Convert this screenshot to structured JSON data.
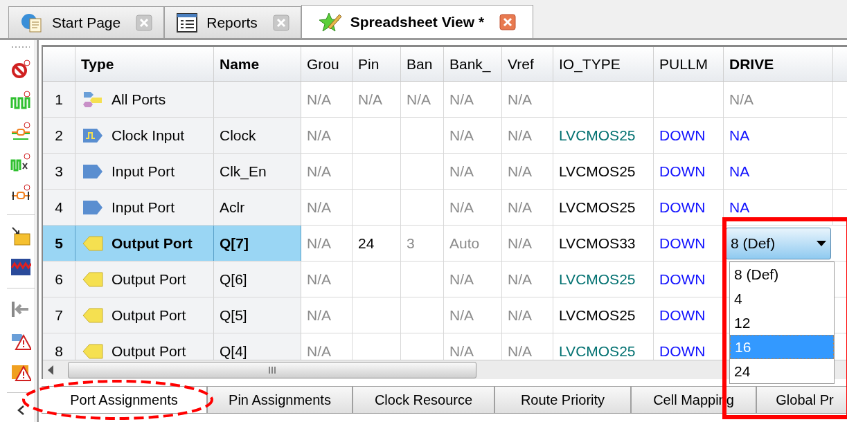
{
  "tabs": [
    {
      "label": "Start Page",
      "kind": "start",
      "selected": false
    },
    {
      "label": "Reports",
      "kind": "reports",
      "selected": false
    },
    {
      "label": "Spreadsheet View *",
      "kind": "spreadsheet",
      "selected": true
    }
  ],
  "table": {
    "columns": [
      {
        "label": "Type",
        "bold": true
      },
      {
        "label": "Name",
        "bold": true
      },
      {
        "label": "Grou",
        "bold": false
      },
      {
        "label": "Pin",
        "bold": false
      },
      {
        "label": "Ban",
        "bold": false
      },
      {
        "label": "Bank_",
        "bold": false
      },
      {
        "label": "Vref",
        "bold": false
      },
      {
        "label": "IO_TYPE",
        "bold": false
      },
      {
        "label": "PULLM",
        "bold": false
      },
      {
        "label": "DRIVE",
        "bold": true
      }
    ],
    "rows": [
      {
        "number": "1",
        "kind": "all",
        "selected": false,
        "cells": [
          {
            "text": "All Ports",
            "kind": "type"
          },
          null,
          {
            "text": "N/A",
            "kind": "dim"
          },
          {
            "text": "N/A",
            "kind": "dim"
          },
          {
            "text": "N/A",
            "kind": "dim"
          },
          {
            "text": "N/A",
            "kind": "dim"
          },
          {
            "text": "N/A",
            "kind": "dim"
          },
          null,
          null,
          {
            "text": "N/A",
            "kind": "dim"
          }
        ]
      },
      {
        "number": "2",
        "kind": "clock",
        "selected": false,
        "cells": [
          {
            "text": "Clock Input",
            "kind": "type"
          },
          {
            "text": "Clock",
            "kind": "name"
          },
          {
            "text": "N/A",
            "kind": "dim"
          },
          null,
          null,
          {
            "text": "N/A",
            "kind": "dim"
          },
          {
            "text": "N/A",
            "kind": "dim"
          },
          {
            "text": "LVCMOS25",
            "kind": "inherited"
          },
          {
            "text": "DOWN",
            "kind": "enum"
          },
          {
            "text": "NA",
            "kind": "enum"
          }
        ]
      },
      {
        "number": "3",
        "kind": "input",
        "selected": false,
        "cells": [
          {
            "text": "Input Port",
            "kind": "type"
          },
          {
            "text": "Clk_En",
            "kind": "name"
          },
          {
            "text": "N/A",
            "kind": "dim"
          },
          null,
          null,
          {
            "text": "N/A",
            "kind": "dim"
          },
          {
            "text": "N/A",
            "kind": "dim"
          },
          {
            "text": "LVCMOS25",
            "kind": "value"
          },
          {
            "text": "DOWN",
            "kind": "enum"
          },
          {
            "text": "NA",
            "kind": "enum"
          }
        ]
      },
      {
        "number": "4",
        "kind": "input",
        "selected": false,
        "cells": [
          {
            "text": "Input Port",
            "kind": "type"
          },
          {
            "text": "Aclr",
            "kind": "name"
          },
          {
            "text": "N/A",
            "kind": "dim"
          },
          null,
          null,
          {
            "text": "N/A",
            "kind": "dim"
          },
          {
            "text": "N/A",
            "kind": "dim"
          },
          {
            "text": "LVCMOS25",
            "kind": "value"
          },
          {
            "text": "DOWN",
            "kind": "enum"
          },
          {
            "text": "NA",
            "kind": "enum"
          }
        ]
      },
      {
        "number": "5",
        "kind": "output",
        "selected": true,
        "cells": [
          {
            "text": "Output Port",
            "kind": "type"
          },
          {
            "text": "Q[7]",
            "kind": "name"
          },
          {
            "text": "N/A",
            "kind": "dim"
          },
          {
            "text": "24",
            "kind": "value"
          },
          {
            "text": "3",
            "kind": "dim"
          },
          {
            "text": "Auto",
            "kind": "dim"
          },
          {
            "text": "N/A",
            "kind": "dim"
          },
          {
            "text": "LVCMOS33",
            "kind": "value"
          },
          {
            "text": "DOWN",
            "kind": "enum"
          },
          {
            "text": "8 (Def)",
            "kind": "dropdown"
          }
        ]
      },
      {
        "number": "6",
        "kind": "output",
        "selected": false,
        "cells": [
          {
            "text": "Output Port",
            "kind": "type"
          },
          {
            "text": "Q[6]",
            "kind": "name"
          },
          {
            "text": "N/A",
            "kind": "dim"
          },
          null,
          null,
          {
            "text": "N/A",
            "kind": "dim"
          },
          {
            "text": "N/A",
            "kind": "dim"
          },
          {
            "text": "LVCMOS25",
            "kind": "inherited"
          },
          {
            "text": "DOWN",
            "kind": "enum"
          },
          null
        ]
      },
      {
        "number": "7",
        "kind": "output",
        "selected": false,
        "cells": [
          {
            "text": "Output Port",
            "kind": "type"
          },
          {
            "text": "Q[5]",
            "kind": "name"
          },
          {
            "text": "N/A",
            "kind": "dim"
          },
          null,
          null,
          {
            "text": "N/A",
            "kind": "dim"
          },
          {
            "text": "N/A",
            "kind": "dim"
          },
          {
            "text": "LVCMOS25",
            "kind": "value"
          },
          {
            "text": "DOWN",
            "kind": "enum"
          },
          null
        ]
      },
      {
        "number": "8",
        "kind": "output",
        "selected": false,
        "cells": [
          {
            "text": "Output Port",
            "kind": "type"
          },
          {
            "text": "Q[4]",
            "kind": "name"
          },
          {
            "text": "N/A",
            "kind": "dim"
          },
          null,
          null,
          {
            "text": "N/A",
            "kind": "dim"
          },
          {
            "text": "N/A",
            "kind": "dim"
          },
          {
            "text": "LVCMOS25",
            "kind": "inherited"
          },
          {
            "text": "DOWN",
            "kind": "enum"
          },
          null
        ]
      }
    ],
    "dropdown_options": [
      {
        "label": "8 (Def)",
        "selected": false
      },
      {
        "label": "4",
        "selected": false
      },
      {
        "label": "12",
        "selected": false
      },
      {
        "label": "16",
        "selected": true
      },
      {
        "label": "24",
        "selected": false
      }
    ]
  },
  "bottom_tabs": [
    {
      "label": "Port Assignments",
      "selected": true
    },
    {
      "label": "Pin Assignments",
      "selected": false
    },
    {
      "label": "Clock Resource",
      "selected": false
    },
    {
      "label": "Route Priority",
      "selected": false
    },
    {
      "label": "Cell Mapping",
      "selected": false
    },
    {
      "label": "Global Pr",
      "selected": false
    }
  ]
}
